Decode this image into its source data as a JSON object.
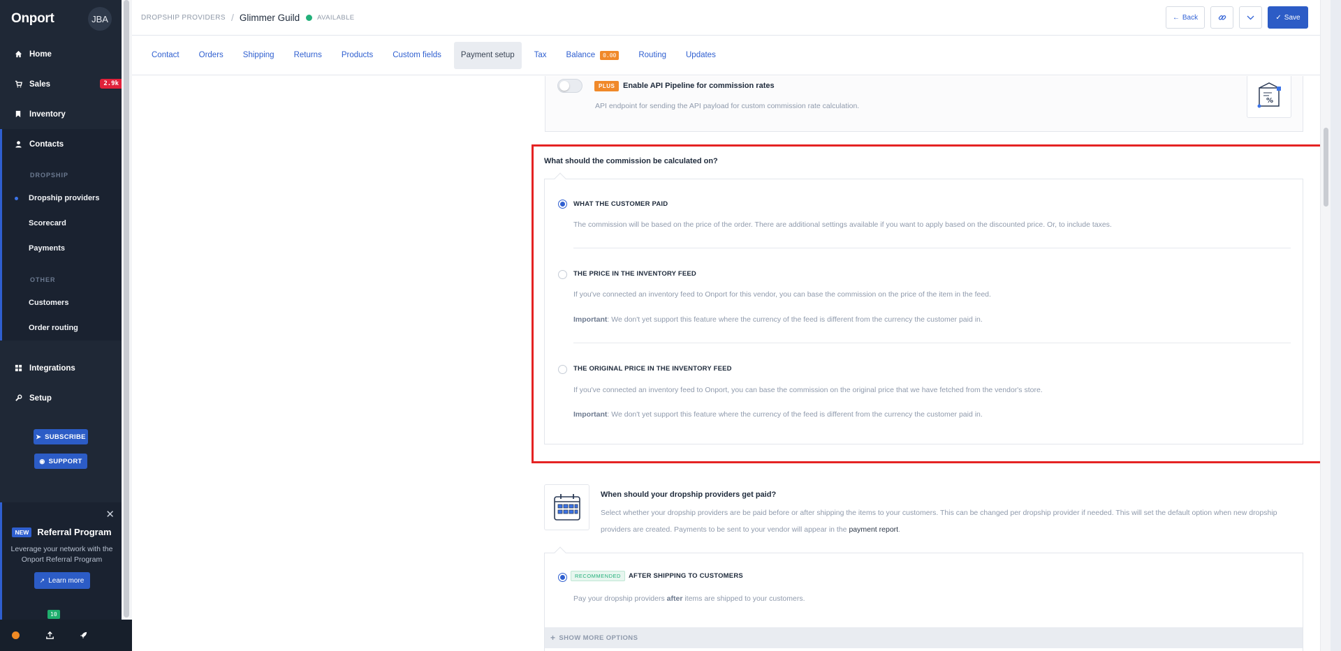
{
  "app": {
    "logo": "Onport",
    "user_initials": "JBA"
  },
  "sidebar": {
    "nav": [
      {
        "label": "Home",
        "icon": "home-icon"
      },
      {
        "label": "Sales",
        "icon": "cart-icon",
        "badge": "2.9k"
      },
      {
        "label": "Inventory",
        "icon": "bookmark-icon"
      },
      {
        "label": "Contacts",
        "icon": "user-icon"
      }
    ],
    "dropship_heading": "DROPSHIP",
    "dropship_items": [
      "Dropship providers",
      "Scorecard",
      "Payments"
    ],
    "other_heading": "OTHER",
    "other_items": [
      "Customers",
      "Order routing"
    ],
    "bottom_nav": [
      {
        "label": "Integrations",
        "icon": "grid-icon"
      },
      {
        "label": "Setup",
        "icon": "wrench-icon"
      }
    ],
    "subscribe_label": "SUBSCRIBE",
    "support_label": "SUPPORT",
    "referral": {
      "new_tag": "NEW",
      "title": "Referral Program",
      "text": "Leverage your network with the Onport Referral Program",
      "button": "Learn more"
    },
    "footer": {
      "upload_badge": "10"
    }
  },
  "header": {
    "breadcrumb": "DROPSHIP PROVIDERS",
    "provider_name": "Glimmer Guild",
    "status": "AVAILABLE",
    "back_label": "Back",
    "save_label": "Save"
  },
  "tabs": [
    {
      "label": "Contact"
    },
    {
      "label": "Orders"
    },
    {
      "label": "Shipping"
    },
    {
      "label": "Returns"
    },
    {
      "label": "Products"
    },
    {
      "label": "Custom fields"
    },
    {
      "label": "Payment setup",
      "active": true
    },
    {
      "label": "Tax"
    },
    {
      "label": "Balance",
      "badge": "0.00"
    },
    {
      "label": "Routing"
    },
    {
      "label": "Updates"
    }
  ],
  "api_pipeline": {
    "tag": "PLUS",
    "title": "Enable API Pipeline for commission rates",
    "description": "API endpoint for sending the API payload for custom commission rate calculation.",
    "enabled": false
  },
  "commission": {
    "question": "What should the commission be calculated on?",
    "options": [
      {
        "title": "WHAT THE CUSTOMER PAID",
        "selected": true,
        "description": "The commission will be based on the price of the order. There are additional settings available if you want to apply based on the discounted price. Or, to include taxes."
      },
      {
        "title": "THE PRICE IN THE INVENTORY FEED",
        "selected": false,
        "description": "If you've connected an inventory feed to Onport for this vendor, you can base the commission on the price of the item in the feed.",
        "important_label": "Important",
        "important_text": ": We don't yet support this feature where the currency of the feed is different from the currency the customer paid in."
      },
      {
        "title": "THE ORIGINAL PRICE IN THE INVENTORY FEED",
        "selected": false,
        "description": "If you've connected an inventory feed to Onport, you can base the commission on the original price that we have fetched from the vendor's store.",
        "important_label": "Important",
        "important_text": ": We don't yet support this feature where the currency of the feed is different from the currency the customer paid in."
      }
    ]
  },
  "payment_timing": {
    "question": "When should your dropship providers get paid?",
    "description": "Select whether your dropship providers are be paid before or after shipping the items to your customers. This can be changed per dropship provider if needed. This will set the default option when new dropship providers are created. Payments to be sent to your vendor will appear in the ",
    "link": "payment report",
    "period": ".",
    "recommended_tag": "RECOMMENDED",
    "option_title": "AFTER SHIPPING TO CUSTOMERS",
    "option_desc_before": "Pay your dropship providers ",
    "option_desc_bold": "after",
    "option_desc_after": " items are shipped to your customers.",
    "show_more": "SHOW MORE OPTIONS"
  },
  "colors": {
    "accent": "#2c5cc6",
    "highlight": "#e52323",
    "plus": "#f0892a",
    "available": "#23b07a"
  }
}
